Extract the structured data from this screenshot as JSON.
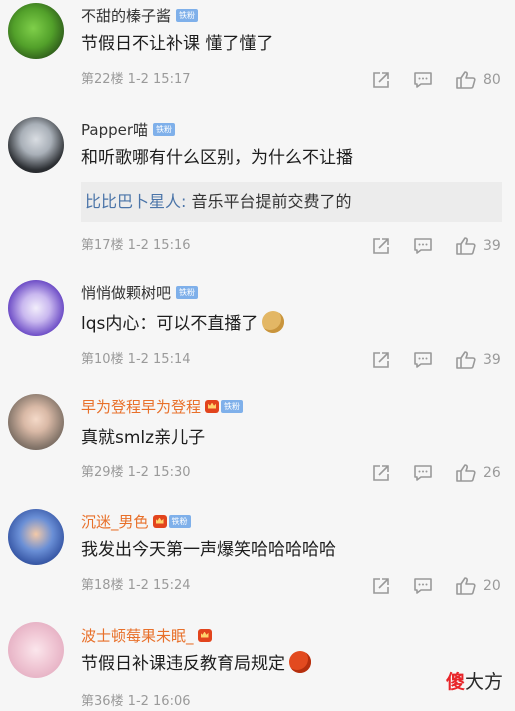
{
  "comments": [
    {
      "username": "不甜的榛子酱",
      "badge": "铁粉",
      "text": "节假日不让补课 懂了懂了",
      "meta": "第22楼 1-2 15:17",
      "likes": "80"
    },
    {
      "username": "Papper喵",
      "badge": "铁粉",
      "text": "和听歌哪有什么区别，为什么不让播",
      "reply": {
        "name": "比比巴卜星人:",
        "text": " 音乐平台提前交费了的"
      },
      "meta": "第17楼 1-2 15:16",
      "likes": "39"
    },
    {
      "username": "悄悄做颗树吧",
      "badge": "铁粉",
      "text": "lqs内心：可以不直播了",
      "meta": "第10楼 1-2 15:14",
      "likes": "39"
    },
    {
      "username": "早为登程早为登程",
      "badge": "铁粉",
      "text": "真就smlz亲儿子",
      "meta": "第29楼 1-2 15:30",
      "likes": "26"
    },
    {
      "username": "沉迷_男色",
      "badge": "铁粉",
      "text": "我发出今天第一声爆笑哈哈哈哈哈",
      "meta": "第18楼 1-2 15:24",
      "likes": "20"
    },
    {
      "username": "波士顿莓果未眠_",
      "text": "节假日补课违反教育局规定",
      "meta": "第36楼 1-2 16:06",
      "likes": ""
    }
  ],
  "watermark": {
    "logo_first": "傻",
    "logo_rest": "大方"
  },
  "icons": [
    "share-icon",
    "comment-icon",
    "like-icon",
    "crown-icon",
    "emoji-doge-icon",
    "emoji-angry-icon"
  ],
  "colors": {
    "vip_name": "#e8702a",
    "badge": "#7fb0ea",
    "reply_name": "#4a74a8",
    "meta": "#9a9a9a"
  }
}
